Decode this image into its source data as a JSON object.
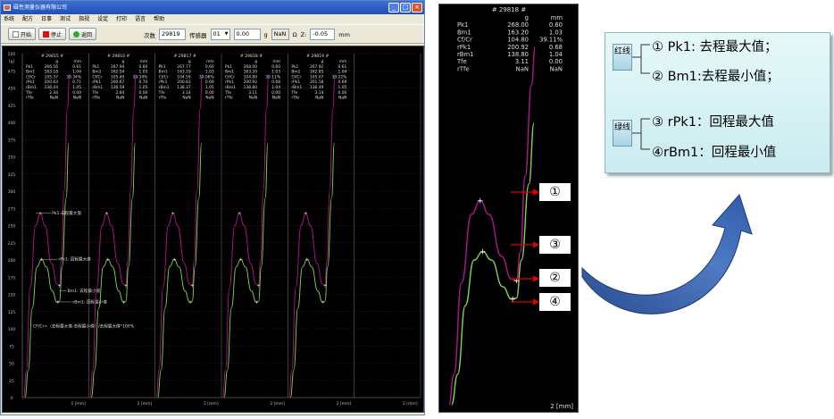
{
  "window": {
    "title": "磁性测量仪器有限公司",
    "menu": [
      "系统",
      "配方",
      "日事",
      "测试",
      "指视",
      "设定",
      "打印",
      "语言",
      "帮助"
    ],
    "toolbar": {
      "start_label": "开始",
      "stop_label": "停止",
      "return_label": "返回",
      "count_label": "次数",
      "count_value": "29819",
      "sensor_label": "传感器",
      "sensor_value": "01",
      "weight_value": "0.00",
      "weight_unit": "g",
      "nan_value": "NaN",
      "ohm_unit": "Ω",
      "z_label": "Z:",
      "z_value": "-0.05",
      "z_unit": "mm"
    },
    "colors": {
      "red_curve": "#b0178a",
      "green_curve": "#7fd64a",
      "grid": "#7a2020"
    }
  },
  "plot": {
    "y_unit": "[g]",
    "y_ticks": [
      "500",
      "475",
      "450",
      "425",
      "400",
      "375",
      "350",
      "325",
      "300",
      "275",
      "250",
      "225",
      "200",
      "175",
      "150",
      "125",
      "100",
      "75",
      "50",
      "25",
      "0"
    ],
    "x_label": "2 [mm]",
    "annotations": {
      "pk1": "Pk1:去程最大值",
      "rpk1": "rPk1: 回程最大值",
      "bm1": "Bm1: 去程最小值",
      "rbm1": "rBm1: 回程最小值",
      "formula": "CF/Cr=（去程最大值-去程最小值）/去程最大值*100%"
    },
    "panels": [
      {
        "id": "# 29815 #",
        "rows": [
          [
            "",
            "g",
            "mm"
          ],
          [
            "Pk1",
            "266.56",
            "0.61"
          ],
          [
            "Bm1",
            "163.18",
            "1.04"
          ],
          [
            "Cf/Cr",
            "105.37",
            "39.34%"
          ],
          [
            "rPk1",
            "200.63",
            "0.71"
          ],
          [
            "rBm1",
            "136.44",
            "1.05"
          ],
          [
            "Tfe",
            "2.34",
            "0.00"
          ],
          [
            "rTfe",
            "NaN",
            "NaN"
          ]
        ]
      },
      {
        "id": "# 29816 #",
        "rows": [
          [
            "",
            "g",
            "mm"
          ],
          [
            "Pk1",
            "267.94",
            "0.60"
          ],
          [
            "Bm1",
            "162.54",
            "1.03"
          ],
          [
            "Cf/Cr",
            "105.40",
            "39.34%"
          ],
          [
            "rPk1",
            "200.67",
            "0.70"
          ],
          [
            "rBm1",
            "136.59",
            "1.05"
          ],
          [
            "Tfe",
            "2.64",
            "0.00"
          ],
          [
            "rTfe",
            "NaN",
            "NaN"
          ]
        ]
      },
      {
        "id": "# 29817 #",
        "rows": [
          [
            "",
            "g",
            "mm"
          ],
          [
            "Pk1",
            "267.77",
            "0.60"
          ],
          [
            "Bm1",
            "163.19",
            "1.03"
          ],
          [
            "Cf/Cr",
            "104.59",
            "39.06%"
          ],
          [
            "rPk1",
            "200.83",
            "0.69"
          ],
          [
            "rBm1",
            "138.37",
            "1.05"
          ],
          [
            "Tfe",
            "3.14",
            "0.00"
          ],
          [
            "rTfe",
            "NaN",
            "NaN"
          ]
        ]
      },
      {
        "id": "# 29818 #",
        "rows": [
          [
            "",
            "g",
            "mm"
          ],
          [
            "Pk1",
            "268.00",
            "0.60"
          ],
          [
            "Bm1",
            "163.20",
            "1.03"
          ],
          [
            "Cf/Cr",
            "104.80",
            "39.11%"
          ],
          [
            "rPk1",
            "200.92",
            "0.68"
          ],
          [
            "rBm1",
            "138.80",
            "1.04"
          ],
          [
            "Tfe",
            "3.11",
            "0.00"
          ],
          [
            "rTfe",
            "NaN",
            "NaN"
          ]
        ]
      },
      {
        "id": "# 29819 #",
        "rows": [
          [
            "",
            "g",
            "mm"
          ],
          [
            "Pk1",
            "267.92",
            "0.61"
          ],
          [
            "Bm1",
            "162.85",
            "1.04"
          ],
          [
            "Cf/Cr",
            "105.07",
            "39.22%"
          ],
          [
            "rPk1",
            "201.18",
            "0.69"
          ],
          [
            "rBm1",
            "136.49",
            "1.05"
          ],
          [
            "Tfe",
            "3.14",
            "0.00"
          ],
          [
            "rTfe",
            "NaN",
            "NaN"
          ]
        ]
      }
    ]
  },
  "zoom": {
    "id": "# 29818 #",
    "rows": [
      [
        "",
        "g",
        "mm"
      ],
      [
        "Pk1",
        "268.00",
        "0.60"
      ],
      [
        "Bm1",
        "163.20",
        "1.03"
      ],
      [
        "Cf/Cr",
        "104.80",
        "39.11%"
      ],
      [
        "rPk1",
        "200.92",
        "0.68"
      ],
      [
        "rBm1",
        "138.80",
        "1.04"
      ],
      [
        "Tfe",
        "3.11",
        "0.00"
      ],
      [
        "rTfe",
        "NaN",
        "NaN"
      ]
    ],
    "x_label": "2 [mm]",
    "callouts": [
      "①",
      "③",
      "②",
      "④"
    ]
  },
  "legend": {
    "red_tag": "红线",
    "green_tag": "绿线",
    "items": [
      "① Pk1: 去程最大值；",
      "② Bm1:去程最小值；",
      "③ rPk1：回程最大值",
      "④rBm1：回程最小值"
    ]
  }
}
